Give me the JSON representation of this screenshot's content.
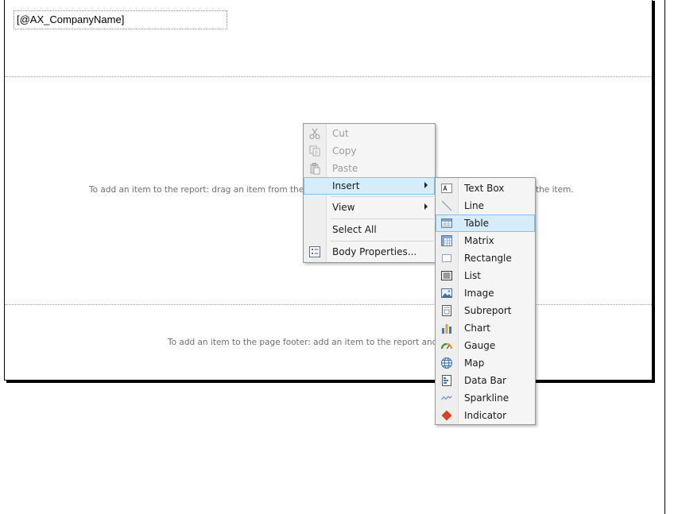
{
  "report": {
    "company_field": "[@AX_CompanyName]",
    "body_hint_left": "To add an item to the report: drag an item from the Too",
    "body_hint_right": "the item.",
    "footer_hint": "To add an item to the page footer: add an item to the report and the"
  },
  "context_menu": {
    "items": [
      {
        "label": "Cut",
        "icon": "scissors-icon",
        "enabled": false
      },
      {
        "label": "Copy",
        "icon": "copy-icon",
        "enabled": false
      },
      {
        "label": "Paste",
        "icon": "paste-icon",
        "enabled": false
      },
      {
        "label": "Insert",
        "submenu": true,
        "highlighted": true
      },
      {
        "label": "View",
        "submenu": true
      },
      {
        "label": "Select All"
      },
      {
        "label": "Body Properties...",
        "icon": "properties-icon"
      }
    ]
  },
  "insert_submenu": {
    "items": [
      {
        "label": "Text Box",
        "icon": "textbox-icon"
      },
      {
        "label": "Line",
        "icon": "line-icon"
      },
      {
        "label": "Table",
        "icon": "table-icon",
        "highlighted": true
      },
      {
        "label": "Matrix",
        "icon": "matrix-icon"
      },
      {
        "label": "Rectangle",
        "icon": "rectangle-icon"
      },
      {
        "label": "List",
        "icon": "list-icon"
      },
      {
        "label": "Image",
        "icon": "image-icon"
      },
      {
        "label": "Subreport",
        "icon": "subreport-icon"
      },
      {
        "label": "Chart",
        "icon": "chart-icon"
      },
      {
        "label": "Gauge",
        "icon": "gauge-icon"
      },
      {
        "label": "Map",
        "icon": "map-icon"
      },
      {
        "label": "Data Bar",
        "icon": "databar-icon"
      },
      {
        "label": "Sparkline",
        "icon": "sparkline-icon"
      },
      {
        "label": "Indicator",
        "icon": "indicator-icon"
      }
    ]
  },
  "colors": {
    "highlight_bg": "#d6ecf9",
    "highlight_border": "#7fc3ee",
    "indicator_red": "#d9441c",
    "chart_blue": "#3a78c2",
    "chart_orange": "#e8a032"
  }
}
